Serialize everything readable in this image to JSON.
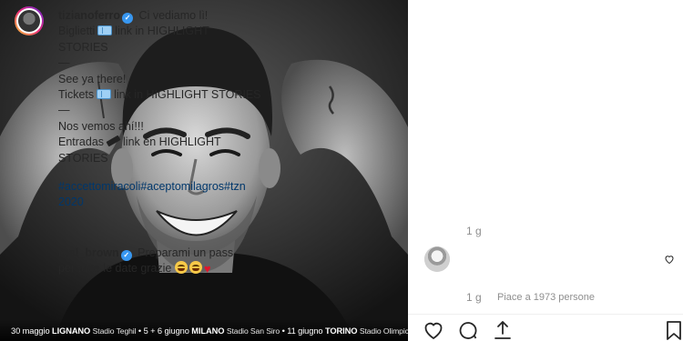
{
  "photo": {
    "tour_line": {
      "d1": "30 maggio",
      "c1": "LIGNANO",
      "v1": "Stadio Teghil",
      "sep1": "•",
      "d2": "5 + 6 giugno",
      "c2": "MILANO",
      "v2": "Stadio San Siro",
      "sep2": "•",
      "d3": "11 giugno",
      "c3": "TORINO",
      "v3": "Stadio Olimpico"
    }
  },
  "post": {
    "username": "tizianoferro",
    "caption_lines": [
      "Ci vediamo lì!",
      "Biglietti",
      "link in HIGHLIGHT",
      "STORIES",
      "—",
      "See ya there!",
      "Tickets",
      "link in HIGHLIGHT STORIES",
      "—",
      "Nos vemos ahí!!!",
      "Entradas",
      "link en HIGHLIGHT",
      "STORIES"
    ],
    "hashtags_line1": "#accettomiracoli#aceptomilagros#tzn",
    "hashtags_line2": "2020",
    "time": "1 g"
  },
  "reply": {
    "username": "real_brown",
    "text_line1": "Preparami un pass",
    "text_line2": "per tutte le date grazie",
    "time": "1 g",
    "likes": "Piace a 1973 persone"
  },
  "icons": {
    "like": "heart-icon",
    "comment": "comment-icon",
    "share": "share-icon",
    "save": "bookmark-icon"
  }
}
